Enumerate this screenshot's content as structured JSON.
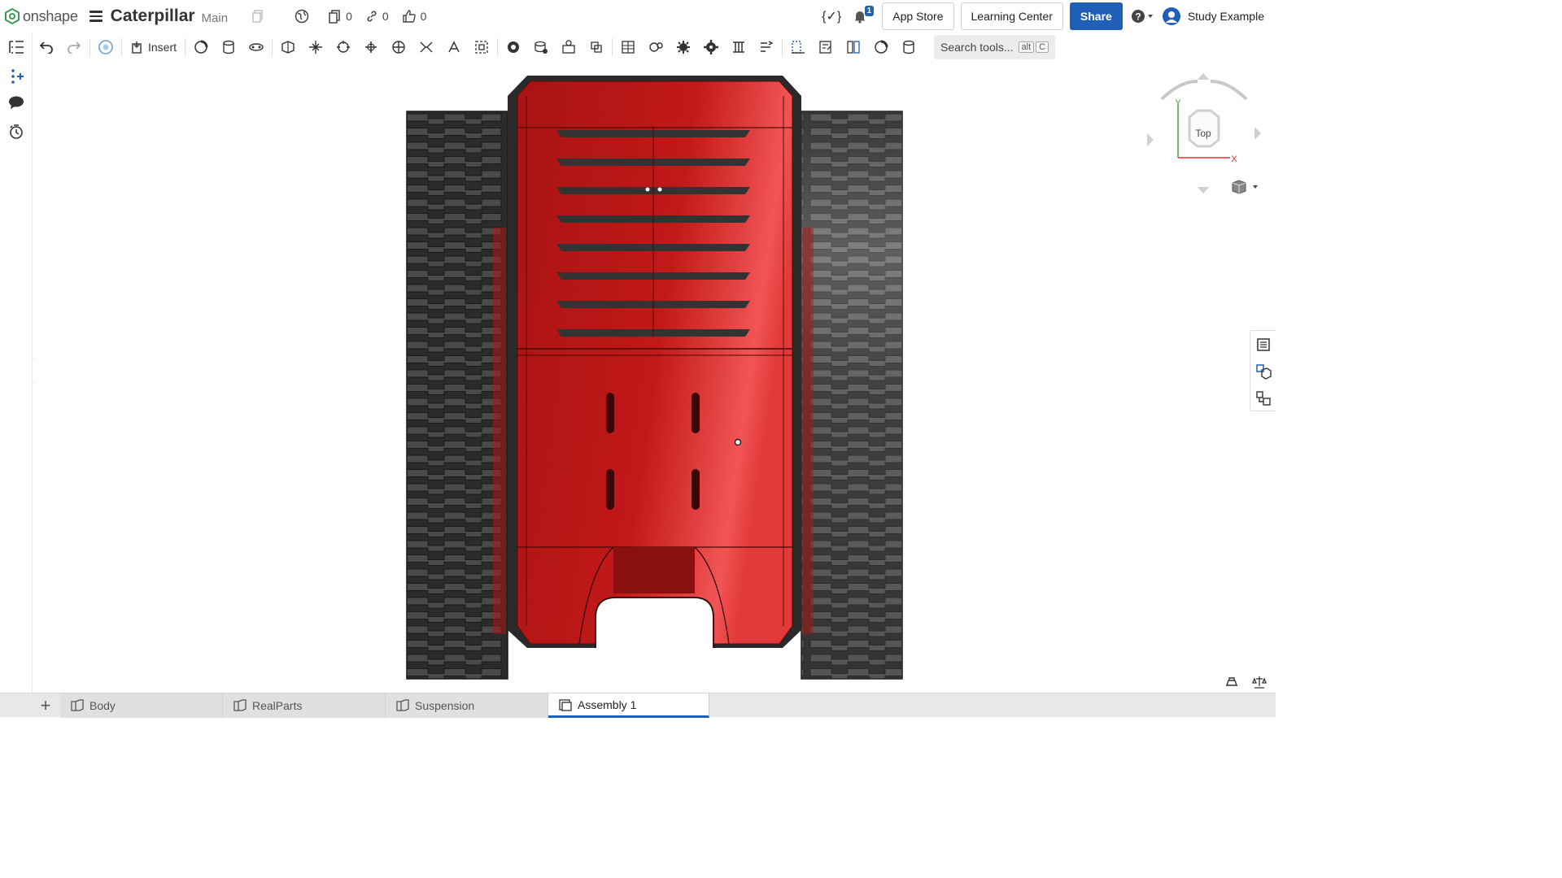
{
  "app": {
    "brand": "onshape",
    "document_title": "Caterpillar",
    "branch": "Main",
    "counts": {
      "versions": "0",
      "links": "0",
      "likes": "0"
    },
    "notifications": "1",
    "buttons": {
      "app_store": "App Store",
      "learning_center": "Learning Center",
      "share": "Share"
    },
    "user": "Study Example"
  },
  "toolbar": {
    "insert_label": "Insert",
    "search_placeholder": "Search tools...",
    "search_shortcut": [
      "alt",
      "C"
    ],
    "tools": [
      "undo-icon",
      "redo-icon",
      "mate-connector-icon",
      "replicate-icon",
      "cylinder-icon",
      "revolute-mate-icon",
      "slider-mate-icon",
      "planar-mate-icon",
      "fastened-mate-icon",
      "rotate-mate-icon",
      "ball-mate-icon",
      "pin-slot-mate-icon",
      "parallel-mate-icon",
      "tangent-mate-icon",
      "group-icon",
      "gear-relation-icon",
      "rack-pinion-icon",
      "screw-relation-icon",
      "linear-relation-icon",
      "exploded-view-icon",
      "named-positions-icon",
      "motion-icon",
      "animate-icon",
      "simulation-icon",
      "measure-icon",
      "section-view-icon",
      "mass-properties-icon",
      "display-states-icon",
      "interference-icon"
    ]
  },
  "viewcube": {
    "face": "Top",
    "axis_y": "Y",
    "axis_x": "X"
  },
  "tabs": [
    {
      "label": "Body",
      "icon": "part-studio-icon",
      "active": false
    },
    {
      "label": "RealParts",
      "icon": "part-studio-icon",
      "active": false
    },
    {
      "label": "Suspension",
      "icon": "part-studio-icon",
      "active": false
    },
    {
      "label": "Assembly 1",
      "icon": "assembly-icon",
      "active": true
    }
  ],
  "colors": {
    "accent": "#1f5fb8",
    "body_red": "#c41a1a",
    "track_dark": "#3a3a3a"
  }
}
